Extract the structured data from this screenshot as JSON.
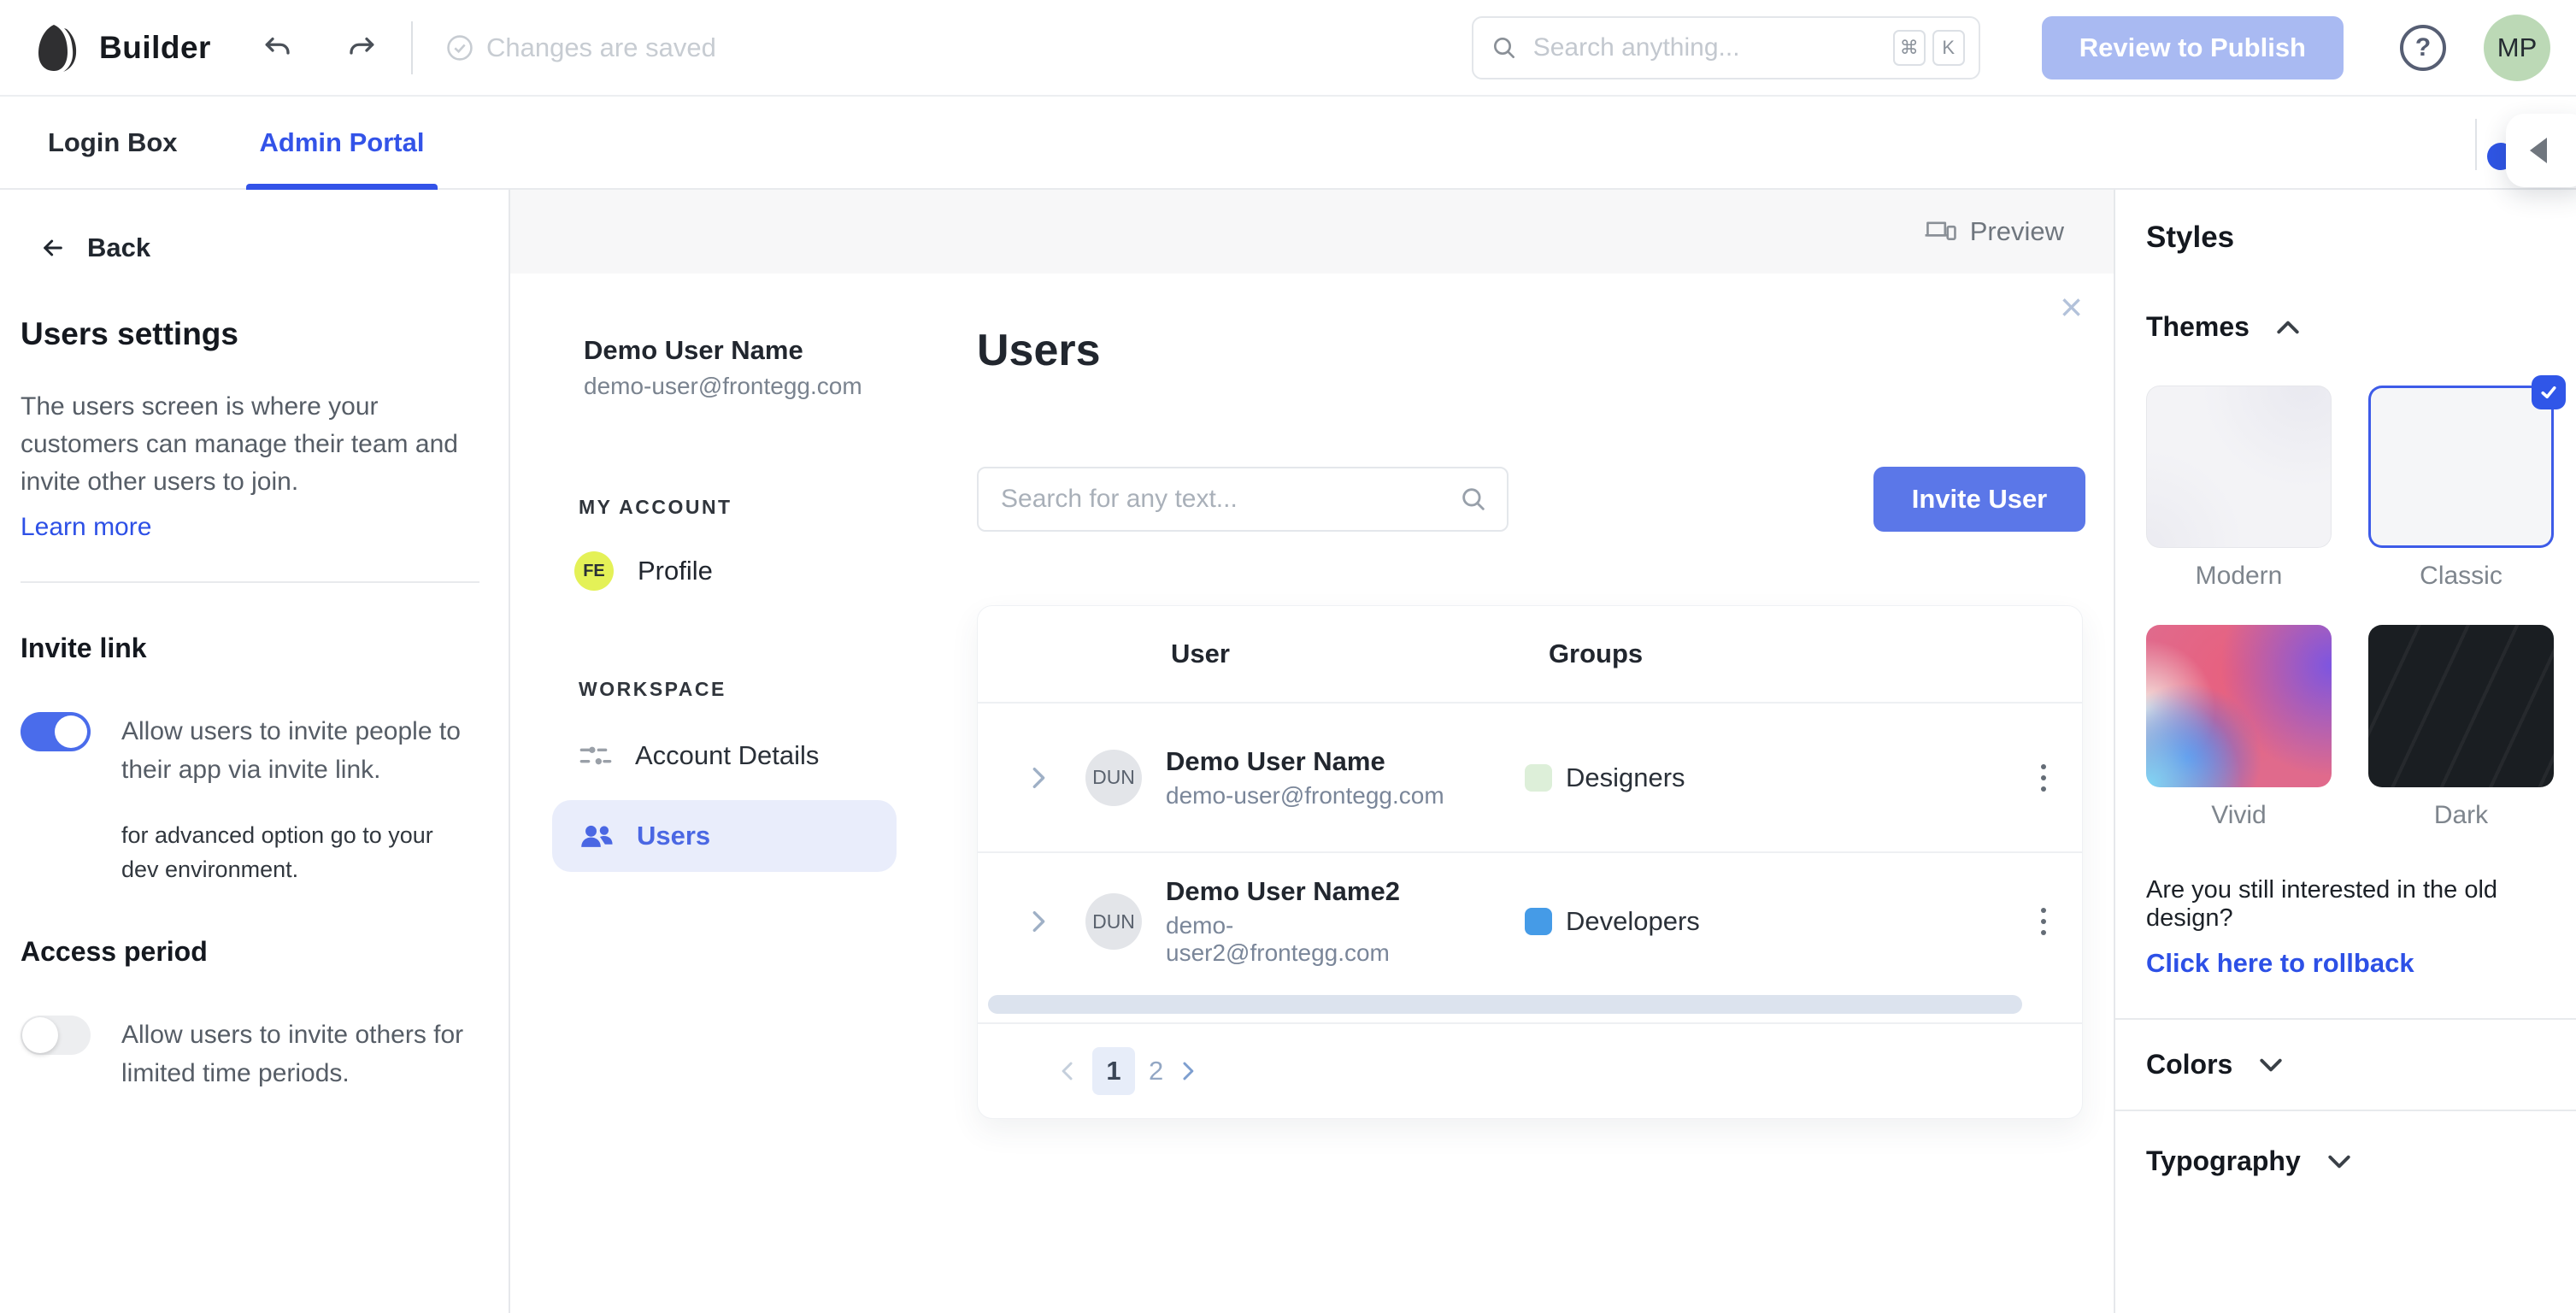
{
  "header": {
    "app_title": "Builder",
    "status_text": "Changes are saved",
    "search_placeholder": "Search anything...",
    "shortcut_keys": [
      "⌘",
      "K"
    ],
    "publish_button": "Review to Publish",
    "help_label": "?",
    "avatar_initials": "MP"
  },
  "tabs": [
    {
      "label": "Login Box",
      "active": false
    },
    {
      "label": "Admin Portal",
      "active": true
    }
  ],
  "sidebar": {
    "back_label": "Back",
    "title": "Users settings",
    "description": "The users screen is where your customers can manage their team and invite other users to join.",
    "learn_more": "Learn more",
    "invite_link": {
      "title": "Invite link",
      "toggle_on": true,
      "label": "Allow users to invite people to their app via invite link.",
      "note": "for advanced option go to your dev environment."
    },
    "access_period": {
      "title": "Access period",
      "toggle_on": false,
      "label": "Allow users to invite others for limited time periods."
    }
  },
  "preview": {
    "preview_button": "Preview",
    "account": {
      "name": "Demo User Name",
      "email": "demo-user@frontegg.com"
    },
    "nav": {
      "my_account_label": "MY ACCOUNT",
      "profile": {
        "avatar_initials": "FE",
        "label": "Profile"
      },
      "workspace_label": "WORKSPACE",
      "account_details_label": "Account Details",
      "users_label": "Users"
    },
    "users_page": {
      "title": "Users",
      "search_placeholder": "Search for any text...",
      "invite_button": "Invite User",
      "table": {
        "columns": [
          "User",
          "Groups"
        ],
        "rows": [
          {
            "initials": "DUN",
            "name": "Demo User Name",
            "email": "demo-user@frontegg.com",
            "group": "Designers",
            "group_color": "#DDEFD9"
          },
          {
            "initials": "DUN",
            "name": "Demo User Name2",
            "email": "demo-user2@frontegg.com",
            "group": "Developers",
            "group_color": "#459BE7"
          }
        ],
        "pagination": {
          "pages": [
            "1",
            "2"
          ],
          "active_page": "1"
        }
      }
    }
  },
  "styles_panel": {
    "title": "Styles",
    "themes": {
      "label": "Themes",
      "expanded": true,
      "options": [
        {
          "label": "Modern",
          "selected": false
        },
        {
          "label": "Classic",
          "selected": true
        },
        {
          "label": "Vivid",
          "selected": false
        },
        {
          "label": "Dark",
          "selected": false
        }
      ]
    },
    "rollback": {
      "question": "Are you still interested in the old design?",
      "link": "Click here to rollback"
    },
    "colors_label": "Colors",
    "typography_label": "Typography",
    "accent_color": "#3353E8"
  }
}
